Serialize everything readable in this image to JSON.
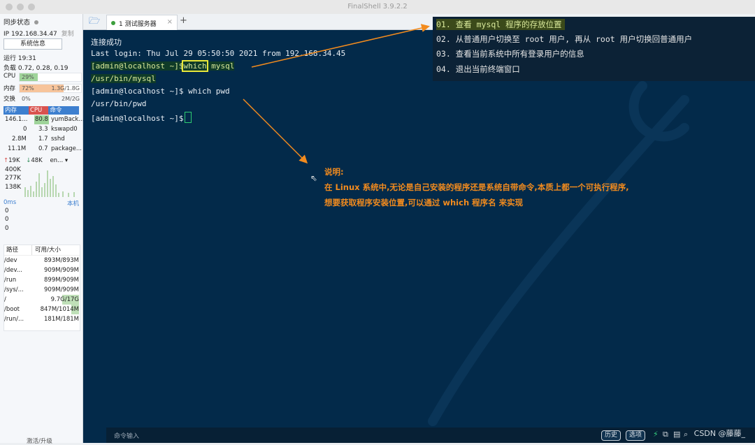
{
  "window": {
    "title": "FinalShell 3.9.2.2"
  },
  "sidebar": {
    "sync_status": "同步状态",
    "ip_line": "IP 192.168.34.47",
    "copy_label": "复制",
    "sysinfo_button": "系统信息",
    "uptime": "运行 19:31",
    "load": "负载 0.72, 0.28, 0.19",
    "cpu": {
      "label": "CPU",
      "value": "29%",
      "percent": 29
    },
    "mem": {
      "label": "内存",
      "value": "72%",
      "detail": "1.3G/1.8G",
      "percent": 72
    },
    "swap": {
      "label": "交换",
      "value": "0%",
      "detail": "2M/2G",
      "percent": 0
    },
    "proc_headers": [
      "内存",
      "CPU",
      "命令"
    ],
    "processes": [
      {
        "mem": "146.1...",
        "cpu": "80.8",
        "cmd": "yumBack..."
      },
      {
        "mem": "0",
        "cpu": "3.3",
        "cmd": "kswapd0"
      },
      {
        "mem": "2.8M",
        "cpu": "1.7",
        "cmd": "sshd"
      },
      {
        "mem": "11.1M",
        "cpu": "0.7",
        "cmd": "package..."
      }
    ],
    "net": {
      "up": "19K",
      "down": "48K",
      "iface": "en...",
      "scale": [
        "400K",
        "277K",
        "138K"
      ]
    },
    "ping": {
      "label": "0ms",
      "host": "本机",
      "values": [
        "0",
        "0",
        "0"
      ]
    },
    "disk_headers": [
      "路径",
      "可用/大小"
    ],
    "disks": [
      {
        "path": "/dev",
        "size": "893M/893M"
      },
      {
        "path": "/dev...",
        "size": "909M/909M"
      },
      {
        "path": "/run",
        "size": "899M/909M"
      },
      {
        "path": "/sys/...",
        "size": "909M/909M"
      },
      {
        "path": "/",
        "size": "9.7G/17G"
      },
      {
        "path": "/boot",
        "size": "847M/1014M"
      },
      {
        "path": "/run/...",
        "size": "181M/181M"
      }
    ],
    "activate": "激活/升级"
  },
  "tabs": [
    {
      "label": "1 测试服务器"
    }
  ],
  "terminal": {
    "lines": [
      "连接成功",
      "Last login: Thu Jul 29 05:50:50 2021 from 192.168.34.45",
      "[admin@localhost ~]$",
      "which",
      "mysql",
      "/usr/bin/mysql",
      "[admin@localhost ~]$ which pwd",
      "/usr/bin/pwd",
      "[admin@localhost ~]$"
    ]
  },
  "history": [
    "01. 查看 mysql 程序的存放位置",
    "02. 从普通用户切换至 root 用户, 再从 root 用户切换回普通用户",
    "03. 查看当前系统中所有登录用户的信息",
    "04. 退出当前终端窗口"
  ],
  "note": {
    "title": "说明:",
    "line1": "在 Linux 系统中,无论是自己安装的程序还是系统自带命令,本质上都一个可执行程序,",
    "line2": "想要获取程序安装位置,可以通过 which 程序名 来实现"
  },
  "cmdbar": {
    "placeholder": "命令输入",
    "history_btn": "历史",
    "options_btn": "选项",
    "brand": "CSDN @藤藤_"
  },
  "colors": {
    "terminal_bg": "#032a4a",
    "accent": "#f28b1e",
    "highlight_box": "#e9e93a"
  }
}
